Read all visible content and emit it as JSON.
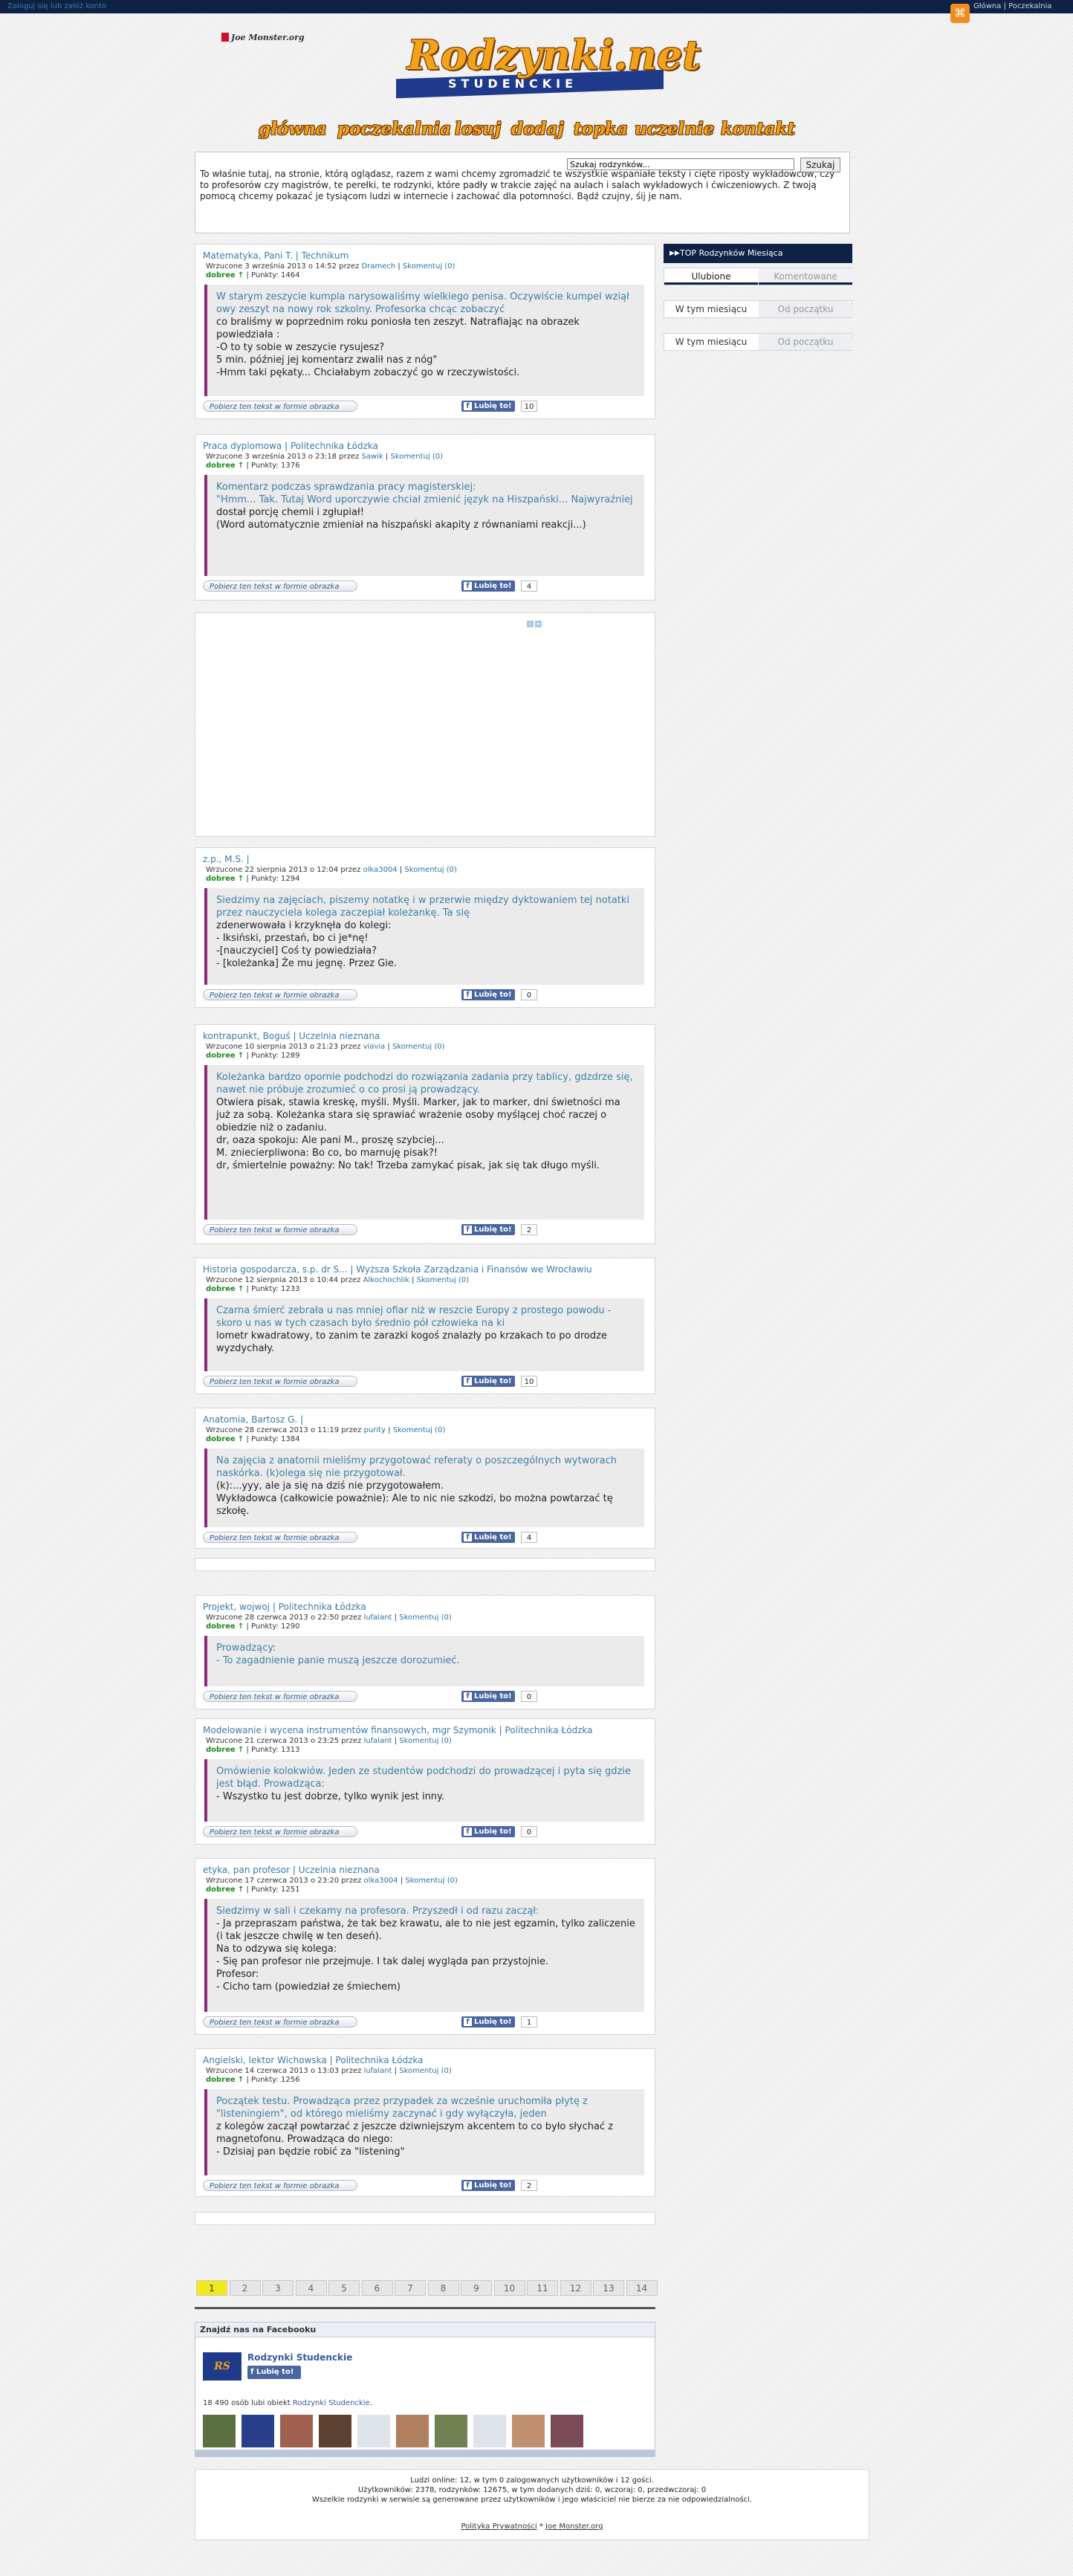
{
  "topbar": {
    "login": "Zaloguj się lub załóż konto",
    "rss_links": "Główna | Poczekalnia"
  },
  "header": {
    "partner": "Joe Monster.org",
    "logo_main": "Rodzynki.net",
    "logo_sub": "STUDENCKIE"
  },
  "nav": [
    "główna",
    "poczekalnia",
    "losuj",
    "dodaj",
    "topka",
    "uczelnie",
    "kontakt"
  ],
  "search": {
    "placeholder": "Szukaj rodzynków...",
    "value": "Szukaj rodzynków...",
    "button": "Szukaj"
  },
  "intro": "To właśnie tutaj, na stronie, którą oglądasz, razem z wami chcemy zgromadzić te wszystkie wspaniałe teksty i cięte riposty wykładowców, czy to profesorów czy magistrów, te perełki, te rodzynki, które padły w trakcie zajęć na aulach i salach wykładowych i ćwiczeniowych. Z twoją pomocą chcemy pokazać je tysiącom ludzi w internecie i zachować dla potomności. Bądź czujny, śij je nam.",
  "common": {
    "obrazek": "Pobierz ten tekst w formie obrazka",
    "like": "Lubię to!",
    "score_word": "dobree",
    "arrow": "↑",
    "punkty": "| Punkty:",
    "komentuj": "Skomentuj (0)",
    "przez": "przez"
  },
  "posts": [
    {
      "lecturer": "Matematyka, Pani T.",
      "school": "Technikum",
      "date": "Wrzucone 3 września 2013 o 14:52",
      "author": "Dramech",
      "points": "1464",
      "likes": "10",
      "lines": [
        {
          "t": "W starym zeszycie kumpla narysowaliśmy wielkiego penisa. Oczywiście kumpel wziął owy zeszyt na nowy rok szkolny. Profesorka chcąc zobaczyć",
          "hl": true
        },
        {
          "t": "co braliśmy w poprzednim roku poniosła ten zeszyt. Natrafiając na obrazek powiedziała :",
          "hl": false
        },
        {
          "t": "-O to ty sobie w zeszycie rysujesz?",
          "hl": false
        },
        {
          "t": "5 min. później jej komentarz zwalił nas z nóg\"",
          "hl": false
        },
        {
          "t": "-Hmm taki pękaty... Chciałabym zobaczyć go w rzeczywistości.",
          "hl": false
        }
      ]
    },
    {
      "lecturer": "Praca dyplomowa",
      "school": "Politechnika Łódzka",
      "date": "Wrzucone 3 września 2013 o 23:18",
      "author": "Sawik",
      "points": "1376",
      "likes": "4",
      "lines": [
        {
          "t": "Komentarz podczas sprawdzania pracy magisterskiej:",
          "hl": true
        },
        {
          "t": " ",
          "hl": false
        },
        {
          "t": "\"Hmm... Tak. Tutaj Word uporczywie chciał zmienić język na Hiszpański... Najwyraźniej",
          "hl": true
        },
        {
          "t": "dostał porcję chemii i zgłupiał!",
          "hl": false
        },
        {
          "t": " ",
          "hl": false
        },
        {
          "t": "(Word automatycznie zmieniał na hiszpański akapity z równaniami reakcji...)",
          "hl": false
        }
      ]
    },
    {
      "lecturer": "z.p., M.S.",
      "school": "",
      "date": "Wrzucone 22 sierpnia 2013 o 12:04",
      "author": "olka3004",
      "points": "1294",
      "likes": "0",
      "lines": [
        {
          "t": "Siedzimy na zajęciach, piszemy notatkę i w przerwie między dyktowaniem tej notatki przez nauczyciela kolega zaczepiał koleżankę. Ta się",
          "hl": true
        },
        {
          "t": "zdenerwowała i krzyknęła do kolegi:",
          "hl": false
        },
        {
          "t": "- Iksiński, przestań, bo ci je*nę!",
          "hl": false
        },
        {
          "t": "-[nauczyciel] Coś ty powiedziała?",
          "hl": false
        },
        {
          "t": "- [koleżanka] Że mu jegnę. Przez Gie.",
          "hl": false
        }
      ]
    },
    {
      "lecturer": "kontrapunkt, Boguś",
      "school": "Uczelnia nieznana",
      "date": "Wrzucone 10 sierpnia 2013 o 21:23",
      "author": "viavia",
      "points": "1289",
      "likes": "2",
      "lines": [
        {
          "t": "Koleżanka bardzo opornie podchodzi do rozwiązania zadania przy tablicy, gdzdrze się, nawet nie próbuje zrozumieć o co prosi ją prowadzący.",
          "hl": true
        },
        {
          "t": "Otwiera pisak, stawia kreskę, myśli. Myśli. Marker, jak to marker, dni świetności ma już za sobą. Koleżanka stara się sprawiać wrażenie osoby myślącej choć raczej o obiedzie niż o zadaniu.",
          "hl": false
        },
        {
          "t": " ",
          "hl": false
        },
        {
          "t": "dr, oaza spokoju: Ale pani M., proszę szybciej...",
          "hl": false
        },
        {
          "t": "M. zniecierpliwona: Bo co, bo marnuję pisak?!",
          "hl": false
        },
        {
          "t": "dr, śmiertelnie poważny: No tak! Trzeba zamykać pisak, jak się tak długo myśli.",
          "hl": false
        }
      ]
    },
    {
      "lecturer": "Historia gospodarcza, s.p. dr S...",
      "school": "Wyższa Szkoła Zarządzania i Finansów we Wrocławiu",
      "date": "Wrzucone 12 sierpnia 2013 o 10:44",
      "author": "Alkochochlik",
      "points": "1233",
      "likes": "10",
      "lines": [
        {
          "t": "Czarna śmierć zebrała u nas mniej ofiar niż w reszcie Europy z prostego powodu - skoro u nas w tych czasach było średnio pół człowieka na ki",
          "hl": true
        },
        {
          "t": "lometr kwadratowy, to zanim te zarazki kogoś znalazły po krzakach to po drodze wyzdychały.",
          "hl": false
        }
      ]
    },
    {
      "lecturer": "Anatomia, Bartosz G.",
      "school": "",
      "date": "Wrzucone 28 czerwca 2013 o 11:19",
      "author": "purity",
      "points": "1384",
      "likes": "4",
      "lines": [
        {
          "t": "Na zajęcia z anatomii mieliśmy przygotować referaty o poszczególnych wytworach naskórka. (k)olega się nie przygotował.",
          "hl": true
        },
        {
          "t": "(k):...yyy, ale ja się na dziś nie przygotowałem.",
          "hl": false
        },
        {
          "t": "Wykładowca (całkowicie poważnie): Ale to nic nie szkodzi, bo można powtarzać tę szkołę.",
          "hl": false
        }
      ]
    },
    {
      "lecturer": "Projekt, wojwoj",
      "school": "Politechnika Łódzka",
      "date": "Wrzucone 28 czerwca 2013 o 22:50",
      "author": "lufalant",
      "points": "1290",
      "likes": "0",
      "lines": [
        {
          "t": "Prowadzący:",
          "hl": true
        },
        {
          "t": "- To zagadnienie panie muszą jeszcze dorozumieć.",
          "hl": true
        }
      ]
    },
    {
      "lecturer": "Modelowanie i wycena instrumentów finansowych, mgr Szymonik",
      "school": "Politechnika Łódzka",
      "date": "Wrzucone 21 czerwca 2013 o 23:25",
      "author": "lufalant",
      "points": "1313",
      "likes": "0",
      "lines": [
        {
          "t": "Omówienie kolokwiów. Jeden ze studentów podchodzi do prowadzącej i pyta się gdzie jest błąd. Prowadząca:",
          "hl": true
        },
        {
          "t": "- Wszystko tu jest dobrze, tylko wynik jest inny.",
          "hl": false
        }
      ]
    },
    {
      "lecturer": "etyka, pan profesor",
      "school": "Uczelnia nieznana",
      "date": "Wrzucone 17 czerwca 2013 o 23:20",
      "author": "olka3004",
      "points": "1251",
      "likes": "1",
      "lines": [
        {
          "t": "Siedzimy w sali i czekamy na profesora. Przyszedł i od razu zaczął:",
          "hl": true
        },
        {
          "t": "- Ja przepraszam państwa, że tak bez krawatu, ale to nie jest egzamin, tylko zaliczenie (i tak jeszcze chwilę w ten deseń).",
          "hl": false
        },
        {
          "t": "Na to odzywa się kolega:",
          "hl": false
        },
        {
          "t": "- Się pan profesor nie przejmuje. I tak dalej wygląda pan przystojnie.",
          "hl": false
        },
        {
          "t": "Profesor:",
          "hl": false
        },
        {
          "t": "- Cicho tam (powiedział ze śmiechem)",
          "hl": false
        }
      ]
    },
    {
      "lecturer": "Angielski, lektor Wichowska",
      "school": "Politechnika Łódzka",
      "date": "Wrzucone 14 czerwca 2013 o 13:03",
      "author": "lufalant",
      "points": "1256",
      "likes": "2",
      "lines": [
        {
          "t": "Początek testu. Prowadząca przez przypadek za wcześnie uruchomiła płytę z \"listeningiem\", od którego mieliśmy zaczynać i gdy wyłączyła, jeden",
          "hl": true
        },
        {
          "t": "z kolegów zaczął powtarzać z jeszcze dziwniejszym akcentem to co było słychać z magnetofonu. Prowadząca do niego:",
          "hl": false
        },
        {
          "t": "- Dzisiaj pan będzie robić za \"listening\"",
          "hl": false
        }
      ]
    }
  ],
  "sidebar": {
    "title": "TOP Rodzynków Miesiąca",
    "tabs1": [
      "Ulubione",
      "Komentowane"
    ],
    "tabs2": [
      "W tym miesiącu",
      "Od początku"
    ],
    "tabs3": [
      "W tym miesiącu",
      "Od początku"
    ]
  },
  "pager": [
    "1",
    "2",
    "3",
    "4",
    "5",
    "6",
    "7",
    "8",
    "9",
    "10",
    "11",
    "12",
    "13",
    "14"
  ],
  "facebook": {
    "header": "Znajdź nas na Facebooku",
    "page_name": "Rodzynki Studenckie",
    "like": "Lubię to!",
    "count_text": "18 490 osób lubi obiekt",
    "count_link": "Rodzynki Studenckie",
    "logo": "RS"
  },
  "footer": {
    "line1": "Ludzi online: 12, w tym 0 zalogowanych użytkowników i 12 gości.",
    "line2": "Użytkowników: 2378, rodzynków: 12675, w tym dodanych dziś: 0, wczoraj: 0, przedwczoraj: 0",
    "line3": "Wszelkie rodzynki w serwisie są generowane przez użytkowników i jego właściciel nie bierze za nie odpowiedzialności.",
    "privacy": "Polityka Prywatności",
    "sep": "*",
    "jm": "Joe Monster.org"
  },
  "colors": {
    "navy": "#0e2246",
    "orange": "#f2a31b",
    "link": "#3b7aa8",
    "facebook": "#4a66a0",
    "accent_bar": "#8a2a78"
  }
}
